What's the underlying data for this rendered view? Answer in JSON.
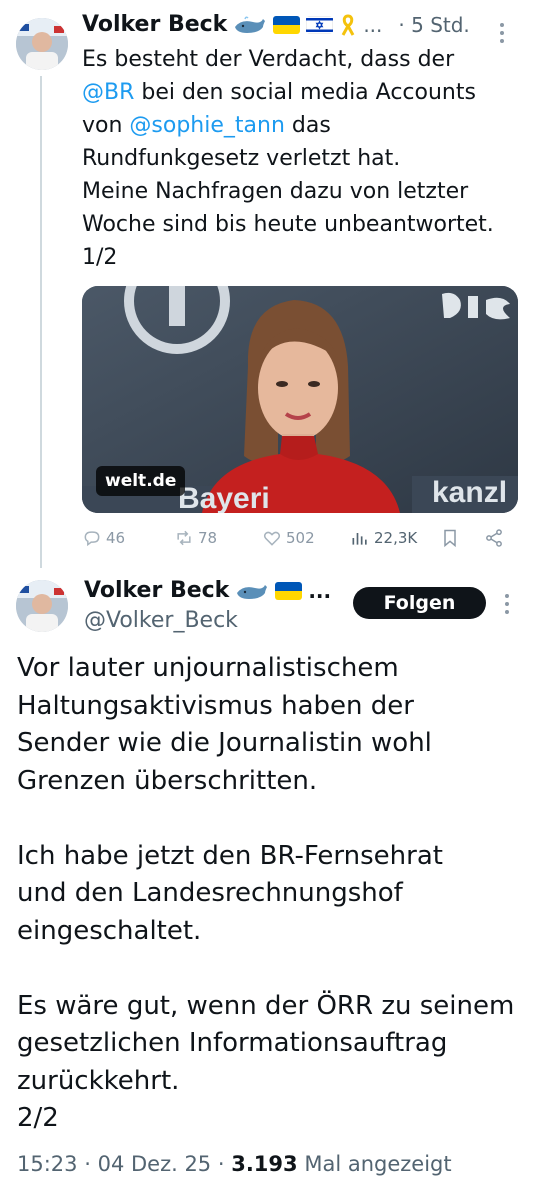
{
  "tweet1": {
    "author": "Volker Beck",
    "name_suffix": "...",
    "time": "· 5 Std.",
    "text_1": "Es besteht der Verdacht, dass der",
    "mention_br": "@BR",
    "text_2": " bei den social media Accounts",
    "text_3": "von ",
    "mention_sophie": "@sophie_tann",
    "text_4": " das",
    "text_5": "Rundfunkgesetz verletzt hat.",
    "text_6": "Meine Nachfragen dazu von letzter",
    "text_7": "Woche sind bis heute unbeantwortet.",
    "text_8": "1/2",
    "media_source": "welt.de",
    "replies": "46",
    "reposts": "78",
    "likes": "502",
    "views": "22,3K"
  },
  "tweet2": {
    "author": "Volker Beck",
    "name_suffix": "...",
    "handle": "@Volker_Beck",
    "follow_label": "Folgen",
    "body_1": "Vor lauter unjournalistischem",
    "body_2": "Haltungsaktivismus haben der",
    "body_3": "Sender wie die Journalistin wohl",
    "body_4": "Grenzen überschritten.",
    "body_5": "Ich habe jetzt den BR-Fernsehrat",
    "body_6": "und den Landesrechnungshof",
    "body_7": "eingeschaltet.",
    "body_8": "Es wäre gut, wenn der ÖRR zu seinem",
    "body_9": "gesetzlichen Informationsauftrag",
    "body_10": "zurückkehrt.",
    "body_11": "2/2",
    "time": "15:23",
    "date": "04 Dez. 25",
    "view_count": "3.193",
    "view_label": "Mal angezeigt"
  },
  "colors": {
    "link": "#1d9bf0",
    "text": "#0f1419",
    "muted": "#536471",
    "follow_bg": "#0f1419"
  },
  "icons": [
    "whale-icon",
    "ukraine-flag-icon",
    "israel-flag-icon",
    "yellow-ribbon-icon",
    "more-icon",
    "reply-icon",
    "repost-icon",
    "like-icon",
    "views-icon",
    "bookmark-icon",
    "share-icon"
  ]
}
